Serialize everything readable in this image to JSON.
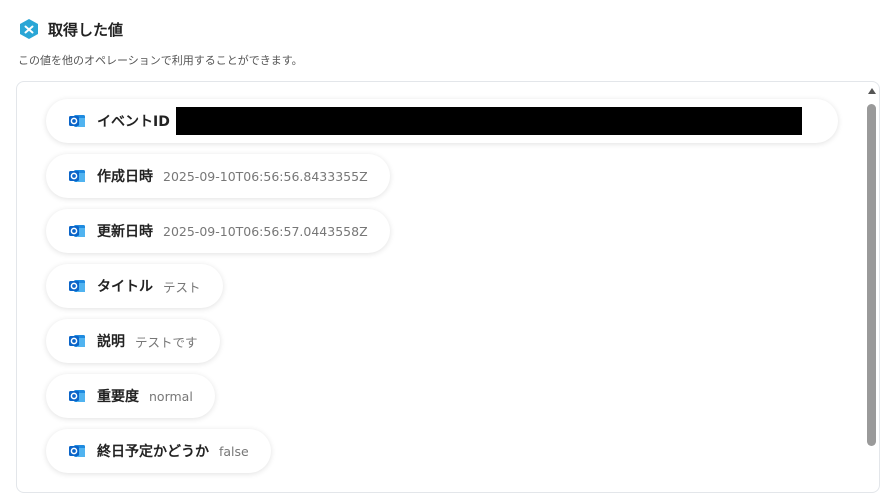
{
  "header": {
    "title": "取得した値",
    "logo_icon": "yoom-logo-icon",
    "subtitle": "この値を他のオペレーションで利用することができます。"
  },
  "colors": {
    "accent": "#2aa6d6",
    "outlook_blue": "#0a64c8",
    "redaction": "#000000"
  },
  "fields": [
    {
      "label": "イベントID",
      "value": "",
      "redacted": true,
      "icon": "outlook-icon"
    },
    {
      "label": "作成日時",
      "value": "2025-09-10T06:56:56.8433355Z",
      "icon": "outlook-icon"
    },
    {
      "label": "更新日時",
      "value": "2025-09-10T06:56:57.0443558Z",
      "icon": "outlook-icon"
    },
    {
      "label": "タイトル",
      "value": "テスト",
      "icon": "outlook-icon"
    },
    {
      "label": "説明",
      "value": "テストです",
      "icon": "outlook-icon"
    },
    {
      "label": "重要度",
      "value": "normal",
      "icon": "outlook-icon"
    },
    {
      "label": "終日予定かどうか",
      "value": "false",
      "icon": "outlook-icon"
    }
  ]
}
